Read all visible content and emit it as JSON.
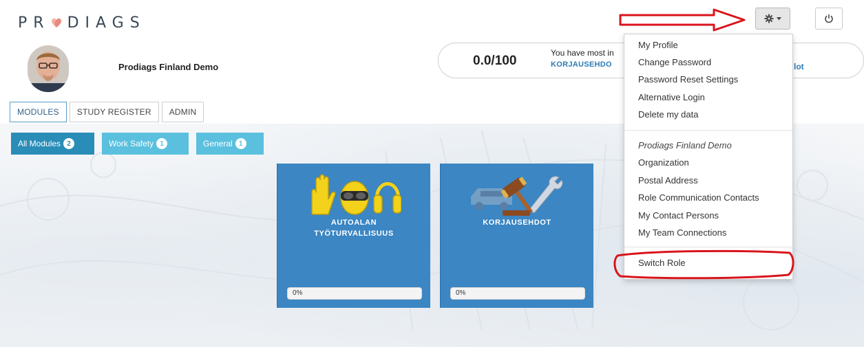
{
  "brand": {
    "logo_text_left": "PR",
    "logo_text_right": "DIAGS"
  },
  "header": {
    "settings_icon": "gear-icon",
    "power_icon": "power-icon"
  },
  "profile": {
    "name": "Prodiags Finland Demo"
  },
  "score": {
    "value": "0.0/100",
    "message": "You have most in",
    "link": "KORJAUSEHDO",
    "link_tail": "lot"
  },
  "tabs": [
    {
      "label": "MODULES",
      "active": true
    },
    {
      "label": "STUDY REGISTER",
      "active": false
    },
    {
      "label": "ADMIN",
      "active": false
    }
  ],
  "filters": [
    {
      "label": "All Modules",
      "count": "2",
      "color": "#2a8db8"
    },
    {
      "label": "Work Safety",
      "count": "1",
      "color": "#5bc0de"
    },
    {
      "label": "General",
      "count": "1",
      "color": "#5bc0de"
    }
  ],
  "modules": [
    {
      "title_line1": "AUTOALAN",
      "title_line2": "TYÖTURVALLISUUS",
      "progress": "0%",
      "icon": "safety-gear-icon"
    },
    {
      "title_line1": "KORJAUSEHDOT",
      "title_line2": "",
      "progress": "0%",
      "icon": "car-gavel-wrench-icon"
    }
  ],
  "menu": {
    "section1": [
      "My Profile",
      "Change Password",
      "Password Reset Settings",
      "Alternative Login",
      "Delete my data"
    ],
    "section2_header": "Prodiags Finland Demo",
    "section2": [
      "Organization",
      "Postal Address",
      "Role Communication Contacts",
      "My Contact Persons",
      "My Team Connections"
    ],
    "section3": [
      "Switch Role"
    ]
  },
  "colors": {
    "card": "#3b86c3",
    "accent": "#2a8db8",
    "annotation": "#d9141c"
  }
}
